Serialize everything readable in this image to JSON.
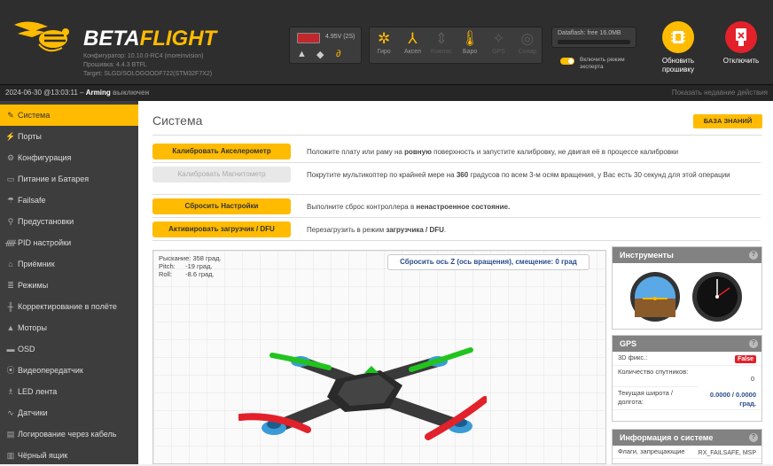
{
  "header": {
    "logo_text_beta": "BETA",
    "logo_text_flight": "FLIGHT",
    "configurator_version": "Конфигуратор: 10.10.0-RC4 (moreinvision)",
    "firmware_version": "Прошивка: 4.4.3 BTFL",
    "target": "Target: SLGD/SOLOGOODF722(STM32F7X2)",
    "battery_voltage": "4.95V (2S)",
    "sensors": [
      {
        "name": "Гиро",
        "icon": "gyro-icon",
        "active": true
      },
      {
        "name": "Аксел",
        "icon": "accel-icon",
        "active": true
      },
      {
        "name": "Компас",
        "icon": "compass-icon",
        "active": false
      },
      {
        "name": "Баро",
        "icon": "baro-icon",
        "active": true
      },
      {
        "name": "GPS",
        "icon": "gps-icon",
        "active": false
      },
      {
        "name": "Сонар",
        "icon": "sonar-icon",
        "active": false
      }
    ],
    "dataflash_label": "Dataflash: free 16.0MB",
    "expert_mode_label": "Включить режим эксперта",
    "update_firmware_label": "Обновить прошивку",
    "disconnect_label": "Отключить"
  },
  "statusbar": {
    "timestamp": "2024-06-30 @13:03:11 –",
    "arming_label": "Arming",
    "arming_state": "выключен",
    "show_actions": "Показать недавние действия"
  },
  "sidebar": {
    "items": [
      {
        "label": "Система",
        "icon": "wrench-icon",
        "active": true
      },
      {
        "label": "Порты",
        "icon": "plug-icon"
      },
      {
        "label": "Конфигурация",
        "icon": "gear-icon"
      },
      {
        "label": "Питание и Батарея",
        "icon": "battery-icon"
      },
      {
        "label": "Failsafe",
        "icon": "failsafe-icon"
      },
      {
        "label": "Предустановки",
        "icon": "presets-icon"
      },
      {
        "label": "PID настройки",
        "icon": "pid-icon"
      },
      {
        "label": "Приёмник",
        "icon": "receiver-icon"
      },
      {
        "label": "Режимы",
        "icon": "modes-icon"
      },
      {
        "label": "Корректирование в полёте",
        "icon": "adjustments-icon"
      },
      {
        "label": "Моторы",
        "icon": "motors-icon"
      },
      {
        "label": "OSD",
        "icon": "osd-icon"
      },
      {
        "label": "Видеопередатчик",
        "icon": "vtx-icon"
      },
      {
        "label": "LED лента",
        "icon": "led-icon"
      },
      {
        "label": "Датчики",
        "icon": "sensors-icon"
      },
      {
        "label": "Логирование через кабель",
        "icon": "logging-icon"
      },
      {
        "label": "Чёрный ящик",
        "icon": "blackbox-icon"
      }
    ]
  },
  "main": {
    "title": "Система",
    "kb_button": "БАЗА ЗНАНИЙ",
    "actions": [
      {
        "button": "Калибровать Акселерометр",
        "enabled": true,
        "desc_pre": "Положите плату или раму на ",
        "desc_bold": "ровную",
        "desc_post": " поверхность и запустите калибровку, не двигая её в процессе калибровки"
      },
      {
        "button": "Калибровать Магнитометр",
        "enabled": false,
        "desc_pre": "Покрутите мультикоптер по крайней мере на ",
        "desc_bold": "360",
        "desc_post": " градусов по всем 3-м осям вращения, у Вас есть 30 секунд для этой операции"
      },
      {
        "button": "Сбросить Настройки",
        "enabled": true,
        "desc_pre": "Выполните сброс контроллера в ",
        "desc_bold": "ненастроенное состояние.",
        "desc_post": ""
      },
      {
        "button": "Активировать загрузчик / DFU",
        "enabled": true,
        "desc_pre": "Перезагрузить в режим ",
        "desc_bold": "загрузчика / DFU",
        "desc_post": "."
      }
    ],
    "attitude": {
      "yaw_label": "Рыскание:",
      "yaw": "358 град.",
      "pitch_label": "Pitch:",
      "pitch": "-19 град.",
      "roll_label": "Roll:",
      "roll": "-8.6 град.",
      "reset_button": "Сбросить ось Z (ось вращения), смещение: 0 град"
    }
  },
  "instruments": {
    "title": "Инструменты"
  },
  "gps": {
    "title": "GPS",
    "fix_label": "3D фикс.:",
    "fix_value": "False",
    "sats_label": "Количество спутников:",
    "sats_value": "0",
    "latlon_label": "Текущая широта / долгота:",
    "latlon_value": "0.0000 / 0.0000 град."
  },
  "sysinfo": {
    "title": "Информация о системе",
    "flags_label": "Флаги, запрещающие",
    "flags_value": "RX_FAILSAFE, MSP"
  },
  "colors": {
    "accent": "#ffbb00",
    "danger": "#e2212b",
    "sidebar": "#3d3d3d",
    "header": "#2e2e2e"
  }
}
